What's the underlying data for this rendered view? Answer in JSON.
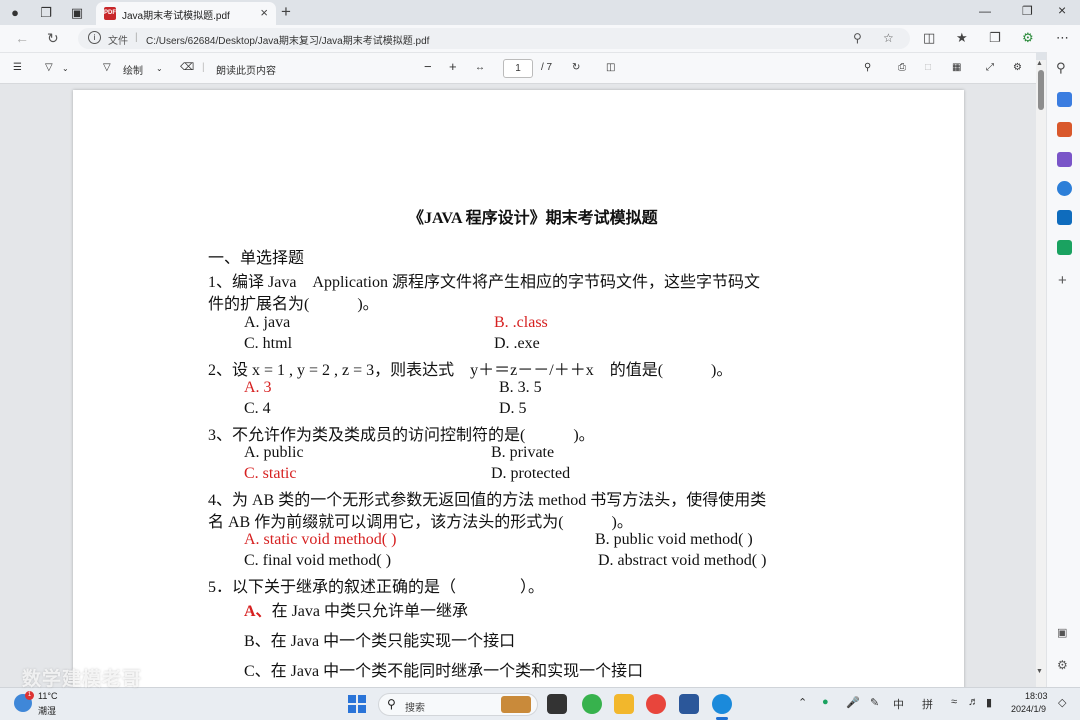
{
  "browser": {
    "tab_title": "Java期末考试模拟题.pdf",
    "address_prefix": "文件",
    "url": "C:/Users/62684/Desktop/Java期末复习/Java期末考试模拟题.pdf"
  },
  "pdf_toolbar": {
    "draw_label": "绘制",
    "read_aloud_label": "朗读此页内容",
    "current_page": "1",
    "total_pages": "/ 7"
  },
  "document": {
    "title": "《JAVA 程序设计》期末考试模拟题",
    "section_heading": "一、单选择题",
    "q1_line1": "1、编译 Java　Application  源程序文件将产生相应的字节码文件，这些字节码文",
    "q1_line2": "件的扩展名为(　　　)。",
    "q1_a": "A. java",
    "q1_b": "B. .class",
    "q1_c": "C. html",
    "q1_d": "D. .exe",
    "q2_line": "2、设  x = 1 , y = 2 , z = 3，则表达式　y＋＝z－－/＋＋x　的值是(　　　)。",
    "q2_a": "A. 3",
    "q2_b": "B. 3. 5",
    "q2_c": "C. 4",
    "q2_d": "D. 5",
    "q3_line": "3、不允许作为类及类成员的访问控制符的是(　　　)。",
    "q3_a": "A. public",
    "q3_b": "B. private",
    "q3_c": "C. static",
    "q3_d": "D. protected",
    "q4_line1": "4、为 AB 类的一个无形式参数无返回值的方法 method 书写方法头，使得使用类",
    "q4_line2": "名 AB 作为前缀就可以调用它，该方法头的形式为(　　　)。",
    "q4_a": "A. static void method( )",
    "q4_b": "B. public void method( )",
    "q4_c": "C. final void method( )",
    "q4_d": "D. abstract void method( )",
    "q5_line": "5．以下关于继承的叙述正确的是（　　　　）。",
    "q5_a_letter": "A、",
    "q5_a_text": "在 Java 中类只允许单一继承",
    "q5_b": "B、在 Java 中一个类只能实现一个接口",
    "q5_c": "C、在 Java 中一个类不能同时继承一个类和实现一个接口"
  },
  "taskbar": {
    "weather_badge": "1",
    "weather_temp": "11°C",
    "weather_condition": "潮湿",
    "search_label": "搜索",
    "ime_lang": "中",
    "ime_mode": "拼",
    "clock_time": "18:03",
    "clock_date": "2024/1/9"
  },
  "watermark": "数学建模老哥",
  "colors": {
    "answer_red": "#d62020",
    "browser_chrome": "#dfe3e8",
    "accent_blue": "#1f6fd1"
  }
}
